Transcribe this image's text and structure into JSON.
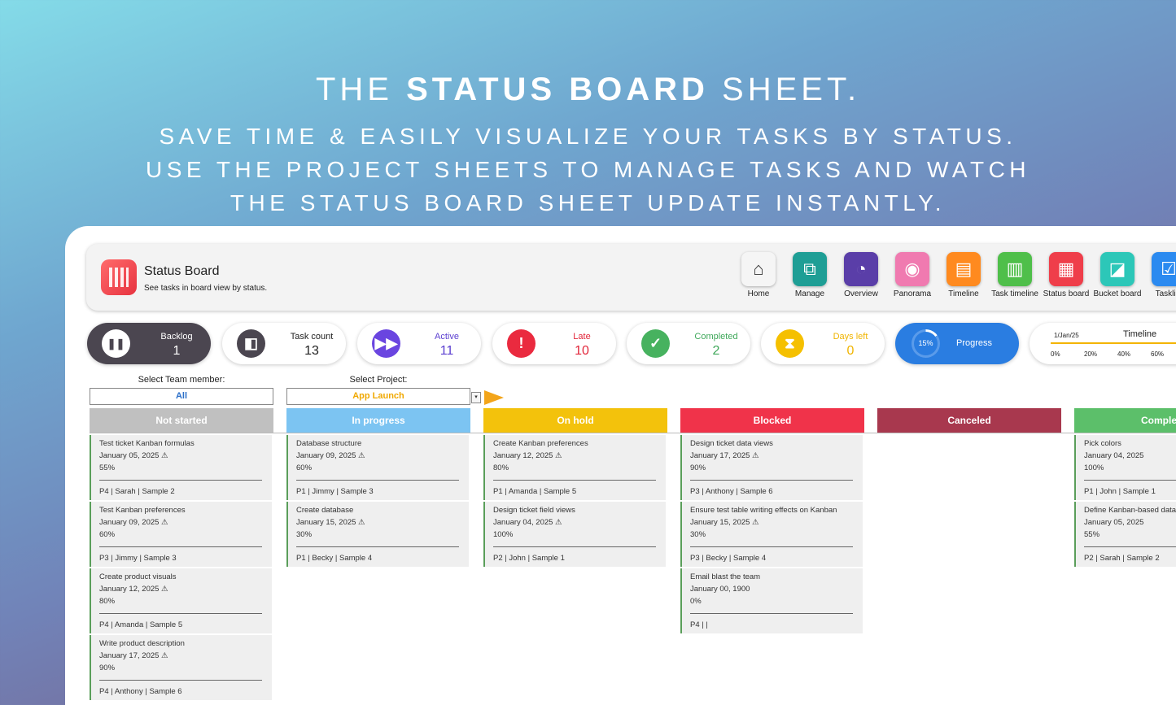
{
  "hero": {
    "title_pre": "THE ",
    "title_bold": "STATUS BOARD",
    "title_post": " SHEET.",
    "line1": "SAVE TIME & EASILY VISUALIZE YOUR TASKS BY STATUS.",
    "line2": "USE THE PROJECT SHEETS TO MANAGE TASKS AND WATCH",
    "line3": "THE STATUS BOARD SHEET UPDATE INSTANTLY."
  },
  "header": {
    "title": "Status Board",
    "subtitle": "See tasks in board view by status.",
    "nav": [
      {
        "label": "Home",
        "icon": "home-icon",
        "color": "#f5f5f5"
      },
      {
        "label": "Manage",
        "icon": "hierarchy-icon",
        "color": "#1e9e95"
      },
      {
        "label": "Overview",
        "icon": "speedometer-icon",
        "color": "#5a3ea8"
      },
      {
        "label": "Panorama",
        "icon": "eye-icon",
        "color": "#f07ab0"
      },
      {
        "label": "Timeline",
        "icon": "timeline-icon",
        "color": "#ff8a1f"
      },
      {
        "label": "Task timeline",
        "icon": "gantt-icon",
        "color": "#4fbf4a"
      },
      {
        "label": "Status board",
        "icon": "board-icon",
        "color": "#ef3e4a"
      },
      {
        "label": "Bucket board",
        "icon": "bucket-icon",
        "color": "#2cc7b8"
      },
      {
        "label": "Tasklist",
        "icon": "checklist-icon",
        "color": "#2b8af0"
      }
    ]
  },
  "kpis": [
    {
      "label": "Backlog",
      "value": "1",
      "icon": "pause-icon",
      "bg": "#4b4650",
      "fg": "#ffffff",
      "icon_bg": "#ffffff",
      "icon_fg": "#4b4650",
      "glyph": "❚❚"
    },
    {
      "label": "Task count",
      "value": "13",
      "icon": "stack-icon",
      "bg": "#ffffff",
      "fg": "#222222",
      "icon_bg": "#4b4650",
      "icon_fg": "#ffffff",
      "glyph": "◧"
    },
    {
      "label": "Active",
      "value": "11",
      "icon": "fast-forward-icon",
      "bg": "#ffffff",
      "fg": "#5b3fd0",
      "icon_bg": "#6a45e0",
      "icon_fg": "#ffffff",
      "glyph": "▶▶"
    },
    {
      "label": "Late",
      "value": "10",
      "icon": "alert-icon",
      "bg": "#ffffff",
      "fg": "#e2263a",
      "icon_bg": "#ea2a3f",
      "icon_fg": "#ffffff",
      "glyph": "!"
    },
    {
      "label": "Completed",
      "value": "2",
      "icon": "check-icon",
      "bg": "#ffffff",
      "fg": "#3fa85a",
      "icon_bg": "#47b25f",
      "icon_fg": "#ffffff",
      "glyph": "✓"
    },
    {
      "label": "Days left",
      "value": "0",
      "icon": "hourglass-icon",
      "bg": "#ffffff",
      "fg": "#f0b400",
      "icon_bg": "#f5c000",
      "icon_fg": "#ffffff",
      "glyph": "⧗"
    }
  ],
  "progress": {
    "label": "Progress",
    "pct": "15%",
    "value": 0.15
  },
  "timeline_widget": {
    "date": "1/Jan/25",
    "label": "Timeline",
    "ticks": [
      "0%",
      "20%",
      "40%",
      "60%"
    ]
  },
  "filters": {
    "team_label": "Select Team member:",
    "team_value": "All",
    "project_label": "Select Project:",
    "project_value": "App Launch"
  },
  "columns": [
    {
      "name": "Not started",
      "color": "#c0c0c0",
      "cards": [
        {
          "title": "Test ticket Kanban formulas",
          "date": "January 05, 2025 ⚠",
          "pct": "55%",
          "meta": "P4 | Sarah | Sample 2"
        },
        {
          "title": "Test Kanban preferences",
          "date": "January 09, 2025 ⚠",
          "pct": "60%",
          "meta": "P3 | Jimmy | Sample 3"
        },
        {
          "title": "Create product visuals",
          "date": "January 12, 2025 ⚠",
          "pct": "80%",
          "meta": "P4 | Amanda | Sample 5"
        },
        {
          "title": "Write product description",
          "date": "January 17, 2025 ⚠",
          "pct": "90%",
          "meta": "P4 | Anthony | Sample 6"
        }
      ]
    },
    {
      "name": "In progress",
      "color": "#7cc4f2",
      "cards": [
        {
          "title": "Database structure",
          "date": "January 09, 2025 ⚠",
          "pct": "60%",
          "meta": "P1 | Jimmy | Sample 3"
        },
        {
          "title": "Create database",
          "date": "January 15, 2025 ⚠",
          "pct": "30%",
          "meta": "P1 | Becky | Sample 4"
        }
      ]
    },
    {
      "name": "On hold",
      "color": "#f3c20c",
      "cards": [
        {
          "title": "Create Kanban preferences",
          "date": "January 12, 2025 ⚠",
          "pct": "80%",
          "meta": "P1 | Amanda | Sample 5"
        },
        {
          "title": "Design ticket field views",
          "date": "January 04, 2025 ⚠",
          "pct": "100%",
          "meta": "P2 | John | Sample 1"
        }
      ]
    },
    {
      "name": "Blocked",
      "color": "#f0334a",
      "cards": [
        {
          "title": "Design ticket data views",
          "date": "January 17, 2025 ⚠",
          "pct": "90%",
          "meta": "P3 | Anthony | Sample 6"
        },
        {
          "title": "Ensure test table writing effects on Kanban",
          "date": "January 15, 2025 ⚠",
          "pct": "30%",
          "meta": "P3 | Becky | Sample 4"
        },
        {
          "title": "Email blast the team",
          "date": "January 00, 1900",
          "pct": "0%",
          "meta": "P4 | |"
        }
      ]
    },
    {
      "name": "Canceled",
      "color": "#a8384e",
      "cards": []
    },
    {
      "name": "Completed",
      "color": "#5cbf6a",
      "cards": [
        {
          "title": "Pick colors",
          "date": "January 04, 2025",
          "pct": "100%",
          "meta": "P1 | John | Sample 1"
        },
        {
          "title": "Define Kanban-based data",
          "date": "January 05, 2025",
          "pct": "55%",
          "meta": "P2 | Sarah | Sample 2"
        }
      ]
    }
  ]
}
